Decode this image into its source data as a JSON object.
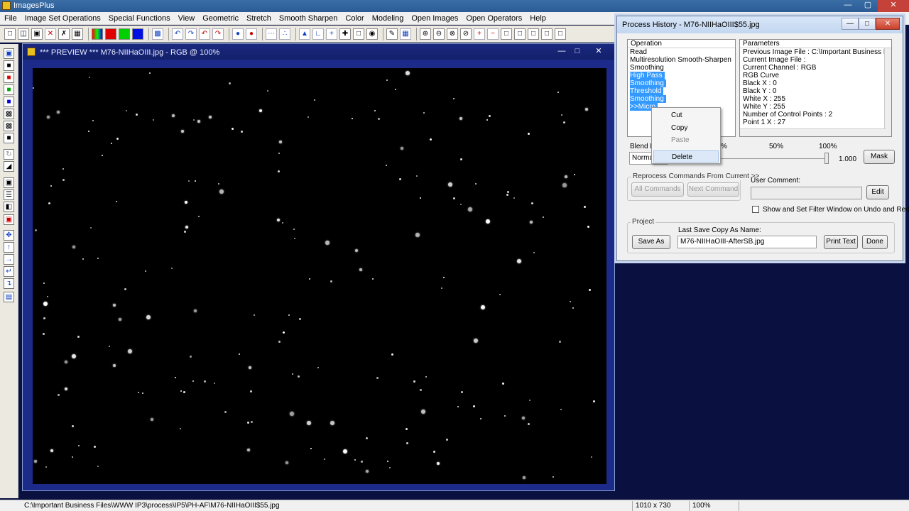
{
  "app": {
    "title": "ImagesPlus"
  },
  "menu": [
    "File",
    "Image Set Operations",
    "Special Functions",
    "View",
    "Geometric",
    "Stretch",
    "Smooth Sharpen",
    "Color",
    "Modeling",
    "Open Images",
    "Open Operators",
    "Help"
  ],
  "preview": {
    "title": "*** PREVIEW *** M76-NIIHaOIII.jpg - RGB @ 100%"
  },
  "process_history": {
    "title": "Process History - M76-NIIHaOIII$55.jpg",
    "operation_header": "Operation",
    "parameters_header": "Parameters",
    "operations": [
      {
        "label": "Read",
        "selected": false
      },
      {
        "label": "Multiresolution Smooth-Sharpen",
        "selected": false
      },
      {
        "label": "Smoothing",
        "selected": false
      },
      {
        "label": "High Pass",
        "selected": true
      },
      {
        "label": "Smoothing",
        "selected": true
      },
      {
        "label": "Threshold",
        "selected": true
      },
      {
        "label": "Smoothing",
        "selected": true
      },
      {
        "label": ">>Micro",
        "selected": true
      }
    ],
    "parameters": [
      "Previous Image File : C:\\Important Business Files\\W",
      "Current Image File :",
      "Current Channel : RGB",
      "RGB Curve",
      " Black X : 0",
      " Black Y : 0",
      " White X : 255",
      " White Y : 255",
      " Number of Control Points : 2",
      "  Point 1 X : 27"
    ],
    "blend_mode_label": "Blend M",
    "blend_mode_value": "Normal",
    "pct_partial": "%",
    "pct_50": "50%",
    "pct_100": "100%",
    "opacity_value": "1.000",
    "mask_button": "Mask",
    "reprocess_label": "Reprocess Commands From Current >>",
    "all_commands_button": "All Commands",
    "next_command_button": "Next Command",
    "user_comment_label": "User Comment:",
    "user_comment_value": "",
    "edit_button": "Edit",
    "show_filter_label": "Show and Set Filter Window on Undo and Redo",
    "project_label": "Project",
    "save_as_button": "Save As",
    "last_save_label": "Last Save Copy As Name:",
    "last_save_value": "M76-NIIHaOIII-AfterSB.jpg",
    "print_text_button": "Print Text",
    "done_button": "Done"
  },
  "context_menu": {
    "cut": "Cut",
    "copy": "Copy",
    "paste": "Paste",
    "delete": "Delete"
  },
  "status": {
    "path": "C:\\Important Business Files\\WWW IP3\\process\\IP5\\PH-AF\\M76-NIIHaOIII$55.jpg",
    "dimensions": "1010 x 730",
    "zoom": "100%"
  },
  "colors": {
    "workspace": "#0a1140",
    "selection": "#3399ff",
    "preview_frame": "#1c2a8a"
  }
}
